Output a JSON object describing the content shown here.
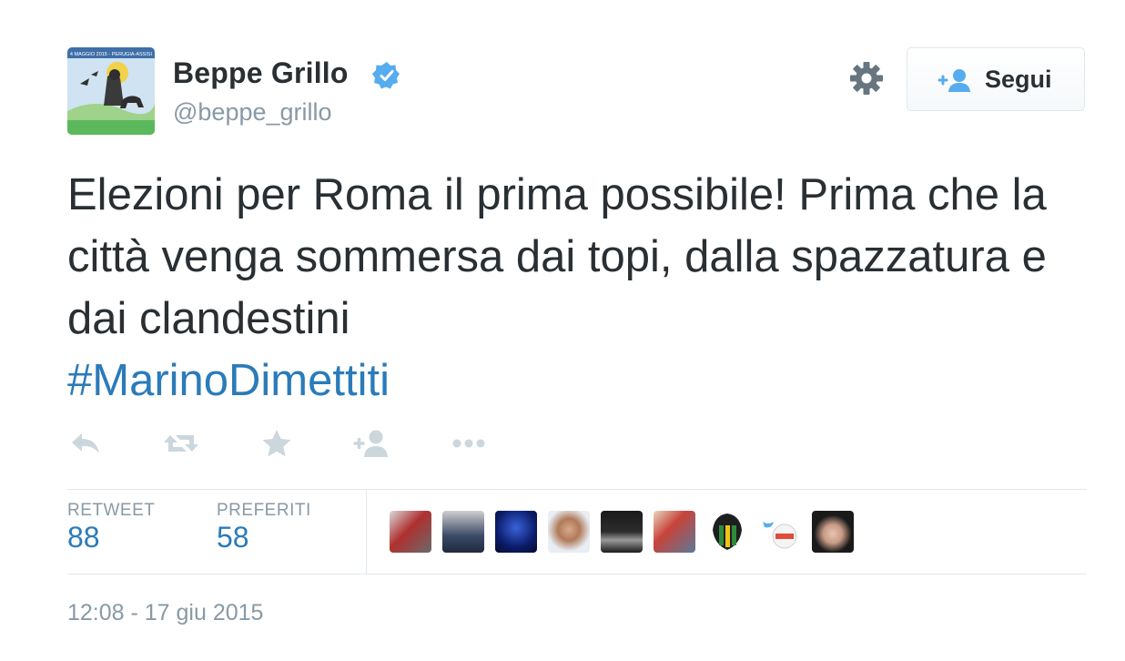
{
  "user": {
    "name": "Beppe Grillo",
    "handle": "@beppe_grillo",
    "verified": true,
    "avatar_banner": "4 MAGGIO 2015 - PERUGIA-ASSISI"
  },
  "follow_button": {
    "label": "Segui",
    "icon": "add-user-icon"
  },
  "settings_icon": "gear-icon",
  "tweet": {
    "text": "Elezioni per Roma il prima possibile! Prima che la città venga sommersa dai topi, dalla spazzatura e dai clandestini",
    "hashtag": "#MarinoDimettiti"
  },
  "actions": [
    "reply-icon",
    "retweet-icon",
    "favorite-icon",
    "follow-icon",
    "more-icon"
  ],
  "stats": {
    "retweets": {
      "label": "RETWEET",
      "value": "88"
    },
    "favorites": {
      "label": "PREFERITI",
      "value": "58"
    }
  },
  "favoriters_count_shown": 9,
  "timestamp": "12:08 - 17 giu 2015",
  "colors": {
    "text": "#292f33",
    "muted": "#8899a6",
    "link": "#2b7bb9",
    "verified": "#55acee",
    "divider": "#e1e8ed",
    "action_icon": "#ccd6dd"
  }
}
